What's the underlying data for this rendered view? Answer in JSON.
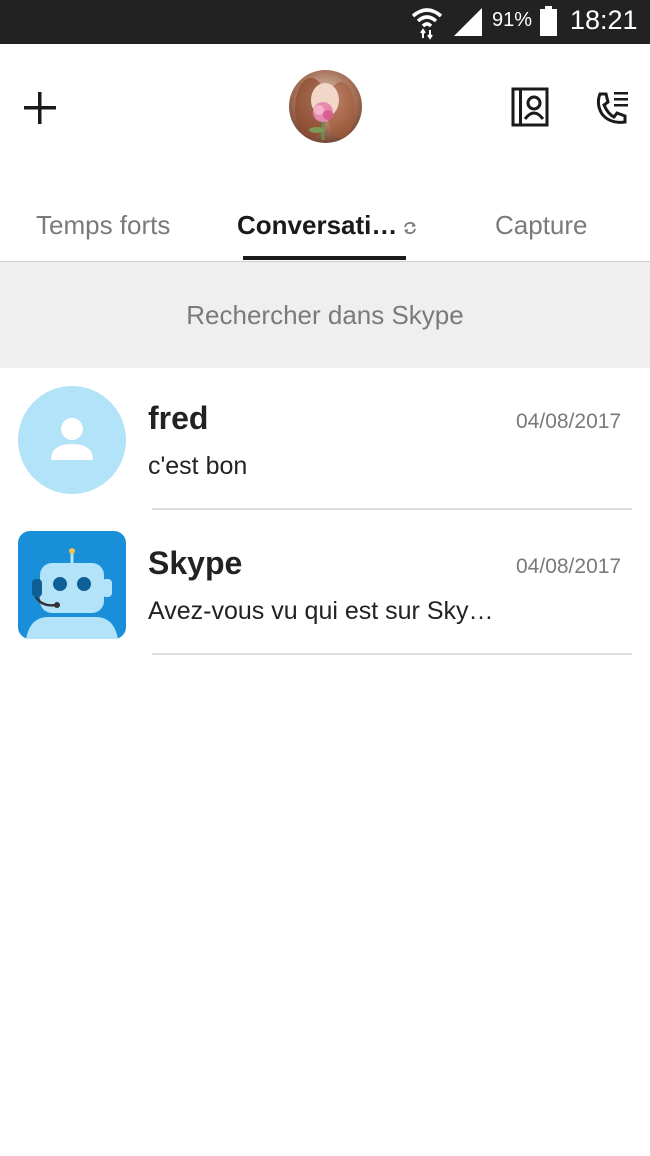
{
  "status_bar": {
    "battery_percent": "91%",
    "time": "18:21"
  },
  "header": {
    "icons": [
      "add-icon",
      "profile-avatar",
      "contacts-icon",
      "call-log-icon"
    ]
  },
  "tabs": [
    {
      "label": "Temps forts",
      "active": false
    },
    {
      "label": "Conversati…",
      "active": true
    },
    {
      "label": "Capture",
      "active": false
    }
  ],
  "search": {
    "placeholder": "Rechercher dans Skype"
  },
  "conversations": [
    {
      "name": "fred",
      "date": "04/08/2017",
      "message": "c'est bon",
      "avatar": "default-person-avatar"
    },
    {
      "name": "Skype",
      "date": "04/08/2017",
      "message": "Avez-vous vu qui est sur Sky…",
      "avatar": "skype-bot-avatar"
    }
  ],
  "colors": {
    "status_bar": "#222222",
    "tab_active": "#1a1a1a",
    "search_bg": "#efefef",
    "default_avatar_bg": "#b3e3f8",
    "bot_avatar_bg": "#1a8fd9"
  }
}
